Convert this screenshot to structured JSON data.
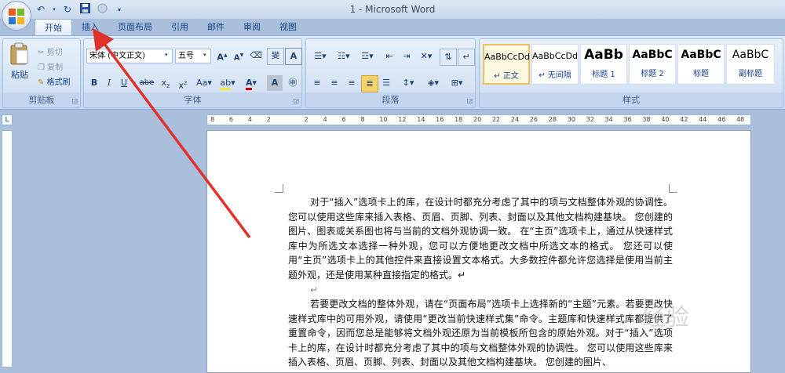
{
  "window": {
    "title": "1 - Microsoft Word"
  },
  "quick_access": {
    "undo_icon": "undo-icon",
    "redo_icon": "redo-icon",
    "save_icon": "save-icon",
    "dropdown_icon": "customize-icon"
  },
  "tabs": [
    "开始",
    "插入",
    "页面布局",
    "引用",
    "邮件",
    "审阅",
    "视图"
  ],
  "clipboard": {
    "paste": "粘贴",
    "cut": "剪切",
    "copy": "复制",
    "format_painter": "格式刷",
    "label": "剪贴板"
  },
  "font": {
    "name": "宋体 (中文正文)",
    "size": "五号",
    "label": "字体"
  },
  "paragraph": {
    "label": "段落"
  },
  "styles": {
    "items": [
      {
        "preview": "AaBbCcDd",
        "name": "↵ 正文"
      },
      {
        "preview": "AaBbCcDd",
        "name": "↵ 无间隔"
      },
      {
        "preview": "AaBb",
        "name": "标题 1"
      },
      {
        "preview": "AaBbC",
        "name": "标题 2"
      },
      {
        "preview": "AaBbC",
        "name": "标题"
      },
      {
        "preview": "AaBbC",
        "name": "副标题"
      }
    ],
    "label": "样式"
  },
  "ruler": {
    "numbers": [
      "8",
      "6",
      "4",
      "2",
      "",
      "2",
      "4",
      "6",
      "8",
      "10",
      "12",
      "14",
      "16",
      "18",
      "20",
      "22",
      "24",
      "26",
      "28",
      "30",
      "32",
      "34",
      "36",
      "38",
      "40",
      "42",
      "44",
      "46",
      "48"
    ]
  },
  "document": {
    "paragraph1": "对于“插入”选项卡上的库，在设计时都充分考虑了其中的项与文档整体外观的协调性。您可以使用这些库来插入表格、页眉、页脚、列表、封面以及其他文档构建基块。 您创建的图片、图表或关系图也将与当前的文档外观协调一致。 在“主页”选项卡上，通过从快速样式库中为所选文本选择一种外观，您可以方便地更改文档中所选文本的格式。 您还可以使用“主页”选项卡上的其他控件来直接设置文本格式。大多数控件都允许您选择是使用当前主题外观，还是使用某种直接指定的格式。↵",
    "empty_line": "↵",
    "paragraph2": "若要更改文档的整体外观，请在“页面布局”选项卡上选择新的“主题”元素。若要更改快速样式库中的可用外观，请使用“更改当前快速样式集”命令。主题库和快速样式库都提供了重置命令，因而您总是能够将文档外观还原为当前模板所包含的原始外观。对于“插入”选项卡上的库，在设计时都充分考虑了其中的项与文档整体外观的协调性。 您可以使用这些库来插入表格、页眉、页脚、列表、封面以及其他文档构建基块。 您创建的图片、"
  },
  "watermark": "经验",
  "colors": {
    "ribbon": "#c9dbf0",
    "arrow": "#e0312a",
    "highlight": "#f5e642",
    "font_color": "#d40000"
  }
}
